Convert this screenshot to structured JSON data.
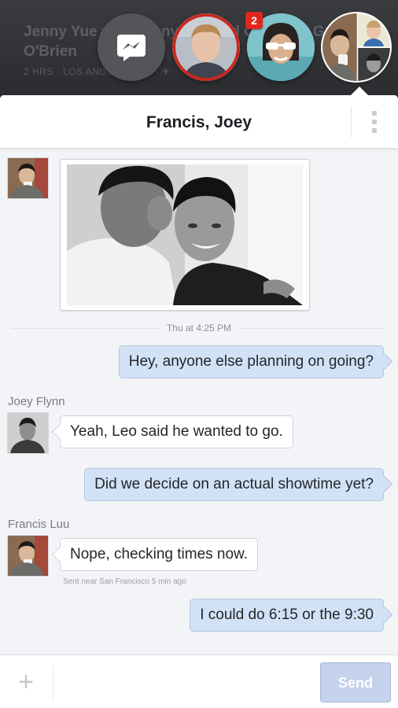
{
  "background_app": {
    "title": "Jenny Yue with Jenny Yue and Christine Griffith O'Brien",
    "meta": "2 HRS · LOS ANGELES, CA · ✈"
  },
  "chat_heads": {
    "items": [
      {
        "id": "messenger",
        "icon": "messenger-bolt-icon"
      },
      {
        "id": "contact-1"
      },
      {
        "id": "contact-2",
        "badge": "2"
      },
      {
        "id": "group-francis-joey",
        "active": true
      }
    ]
  },
  "conversation": {
    "title": "Francis, Joey",
    "timestamp": "Thu at 4:25 PM",
    "messages": [
      {
        "direction": "in",
        "sender": "Francis Luu",
        "type": "photo"
      },
      {
        "direction": "out",
        "text": "Hey, anyone else planning on going?"
      },
      {
        "direction": "in",
        "sender": "Joey Flynn",
        "text": "Yeah, Leo said he wanted to go."
      },
      {
        "direction": "out",
        "text": "Did we decide on an actual showtime yet?"
      },
      {
        "direction": "in",
        "sender": "Francis Luu",
        "text": "Nope, checking times now."
      },
      {
        "direction": "out",
        "text": "I could do 6:15 or the 9:30"
      }
    ],
    "location_note": "Sent near San Francisco 5 min ago"
  },
  "composer": {
    "plus_label": "+",
    "placeholder": "",
    "send_label": "Send"
  },
  "colors": {
    "outgoing_bubble": "#d2e2f6",
    "incoming_bubble": "#ffffff",
    "badge": "#e0271e",
    "send_disabled": "#c4d2ec"
  }
}
